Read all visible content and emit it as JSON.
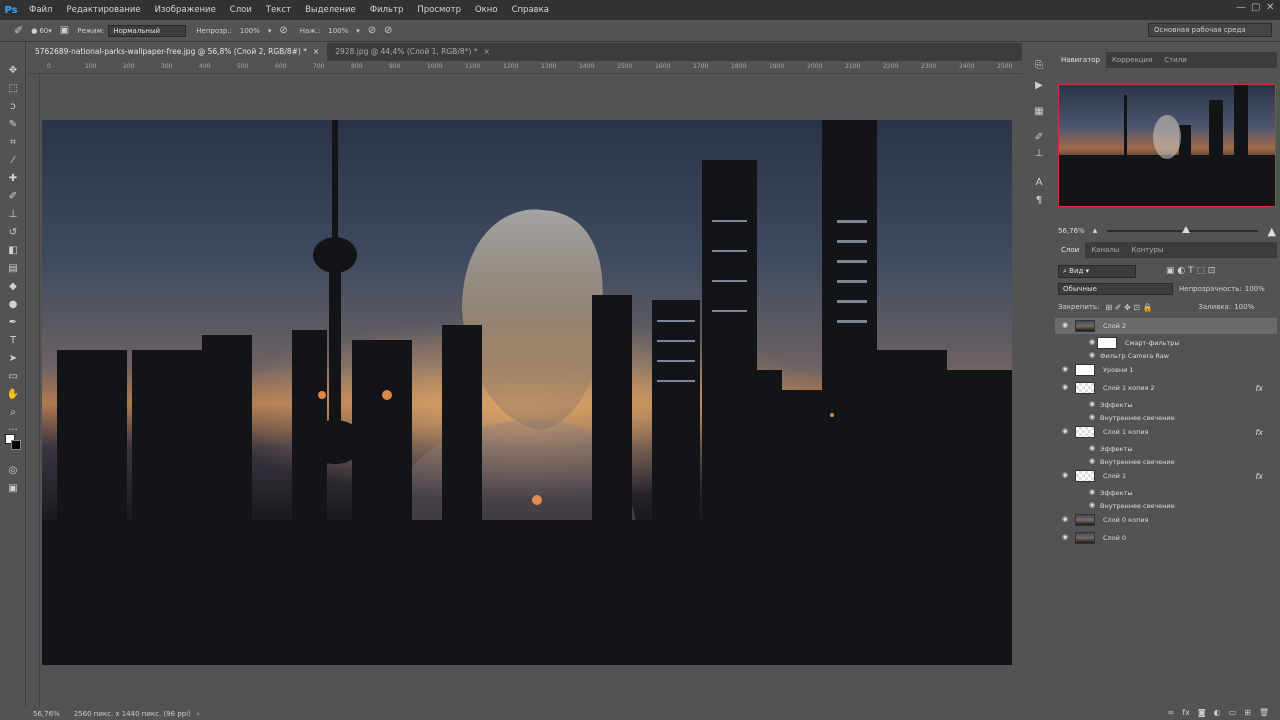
{
  "app": {
    "logo": "Ps"
  },
  "menu": [
    "Файл",
    "Редактирование",
    "Изображение",
    "Слои",
    "Текст",
    "Выделение",
    "Фильтр",
    "Просмотр",
    "Окно",
    "Справка"
  ],
  "window_controls": {
    "minimize": "—",
    "maximize": "▢",
    "close": "✕"
  },
  "options": {
    "brush_size": "60",
    "mode_label": "Режим:",
    "mode_value": "Нормальный",
    "opacity_label": "Непрозр.:",
    "opacity_value": "100%",
    "flow_label": "Наж.:",
    "flow_value": "100%",
    "workspace": "Основная рабочая среда"
  },
  "tabs": [
    {
      "label": "5762689-national-parks-wallpaper-free.jpg @ 56,8% (Слой 2, RGB/8#) *",
      "close": "×"
    },
    {
      "label": "2928.jpg @ 44,4% (Слой 1, RGB/8*) *",
      "close": "×"
    }
  ],
  "ruler_ticks": [
    "0",
    "100",
    "200",
    "300",
    "400",
    "500",
    "600",
    "700",
    "800",
    "900",
    "1000",
    "1100",
    "1200",
    "1300",
    "1400",
    "1500",
    "1600",
    "1700",
    "1800",
    "1900",
    "2000",
    "2100",
    "2200",
    "2300",
    "2400",
    "2500"
  ],
  "status": {
    "zoom": "56,76%",
    "doc_info": "2560 пикс. x 1440 пикс. (96 ppi)",
    "arrow": "›"
  },
  "tools": [
    {
      "icon": "move-tool-icon",
      "glyph": "✥"
    },
    {
      "icon": "marquee-tool-icon",
      "glyph": "⬚"
    },
    {
      "icon": "lasso-tool-icon",
      "glyph": "ↄ"
    },
    {
      "icon": "quick-select-tool-icon",
      "glyph": "✎"
    },
    {
      "icon": "crop-tool-icon",
      "glyph": "⌗"
    },
    {
      "icon": "eyedropper-tool-icon",
      "glyph": "⁄"
    },
    {
      "icon": "healing-tool-icon",
      "glyph": "✚"
    },
    {
      "icon": "brush-tool-icon",
      "glyph": "✐"
    },
    {
      "icon": "stamp-tool-icon",
      "glyph": "⊥"
    },
    {
      "icon": "history-brush-tool-icon",
      "glyph": "↺"
    },
    {
      "icon": "eraser-tool-icon",
      "glyph": "◧"
    },
    {
      "icon": "gradient-tool-icon",
      "glyph": "▤"
    },
    {
      "icon": "blur-tool-icon",
      "glyph": "◆"
    },
    {
      "icon": "dodge-tool-icon",
      "glyph": "●"
    },
    {
      "icon": "pen-tool-icon",
      "glyph": "✒"
    },
    {
      "icon": "type-tool-icon",
      "glyph": "T"
    },
    {
      "icon": "path-select-tool-icon",
      "glyph": "➤"
    },
    {
      "icon": "shape-tool-icon",
      "glyph": "▭"
    },
    {
      "icon": "hand-tool-icon",
      "glyph": "✋"
    },
    {
      "icon": "zoom-tool-icon",
      "glyph": "⌕"
    },
    {
      "icon": "more-tools-icon",
      "glyph": "···"
    }
  ],
  "navigator": {
    "tabs": [
      "Навигатор",
      "Коррекция",
      "Стили"
    ],
    "zoom": "56,76%"
  },
  "layers_panel": {
    "tabs": [
      "Слои",
      "Каналы",
      "Контуры"
    ],
    "filter_label": "Вид",
    "blend_mode": "Обычные",
    "opacity_label": "Непрозрачность:",
    "opacity_value": "100%",
    "lock_label": "Закрепить:",
    "fill_label": "Заливка:",
    "fill_value": "100%",
    "rows": [
      {
        "name": "Слой 2",
        "thumb": "photo",
        "eye": true,
        "selected": true,
        "indent": 0,
        "fx": false
      },
      {
        "name": "Смарт-фильтры",
        "thumb": "white",
        "eye": true,
        "selected": false,
        "indent": 1,
        "fx": false
      },
      {
        "name": "Фильтр Camera Raw",
        "thumb": "none",
        "eye": true,
        "selected": false,
        "indent": 1,
        "fx": false
      },
      {
        "name": "Уровни 1",
        "thumb": "white",
        "eye": true,
        "selected": false,
        "indent": 0,
        "fx": false
      },
      {
        "name": "Слой 1 копия 2",
        "thumb": "checker",
        "eye": true,
        "selected": false,
        "indent": 0,
        "fx": true
      },
      {
        "name": "Эффекты",
        "thumb": "none",
        "eye": true,
        "selected": false,
        "indent": 1,
        "fx": false
      },
      {
        "name": "Внутреннее свечение",
        "thumb": "none",
        "eye": true,
        "selected": false,
        "indent": 1,
        "fx": false
      },
      {
        "name": "Слой 1 копия",
        "thumb": "checker",
        "eye": true,
        "selected": false,
        "indent": 0,
        "fx": true
      },
      {
        "name": "Эффекты",
        "thumb": "none",
        "eye": true,
        "selected": false,
        "indent": 1,
        "fx": false
      },
      {
        "name": "Внутреннее свечение",
        "thumb": "none",
        "eye": true,
        "selected": false,
        "indent": 1,
        "fx": false
      },
      {
        "name": "Слой 1",
        "thumb": "checker",
        "eye": true,
        "selected": false,
        "indent": 0,
        "fx": true
      },
      {
        "name": "Эффекты",
        "thumb": "none",
        "eye": true,
        "selected": false,
        "indent": 1,
        "fx": false
      },
      {
        "name": "Внутреннее свечение",
        "thumb": "none",
        "eye": true,
        "selected": false,
        "indent": 1,
        "fx": false
      },
      {
        "name": "Слой 0 копия",
        "thumb": "photo",
        "eye": true,
        "selected": false,
        "indent": 0,
        "fx": false
      },
      {
        "name": "Слой 0",
        "thumb": "photo",
        "eye": true,
        "selected": false,
        "indent": 0,
        "fx": false
      }
    ],
    "fx_label": "fx",
    "bottom_icons": [
      "∞",
      "fx",
      "◙",
      "◐",
      "▭",
      "⊞",
      "🗑"
    ]
  },
  "colors": {
    "accent": "#31a8ff",
    "nav_border": "#cc3333",
    "panel_bg": "#535353",
    "menubar_bg": "#323232"
  }
}
